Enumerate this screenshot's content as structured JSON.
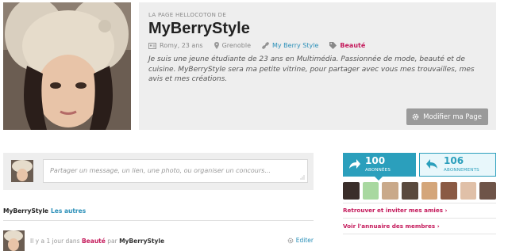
{
  "header": {
    "kicker": "LA PAGE HELLOCOTON DE",
    "title": "MyBerryStyle",
    "meta": {
      "owner": "Romy, 23 ans",
      "location": "Grenoble",
      "blog_link": "My Berry Style",
      "category": "Beauté"
    },
    "bio": "Je suis une jeune étudiante de 23 ans en Multimédia. Passionnée de mode, beauté et de cuisine. MyBerryStyle sera ma petite vitrine, pour partager avec vous mes trouvailles, mes avis et mes créations.",
    "edit_button": "Modifier ma Page"
  },
  "composer": {
    "placeholder": "Partager un message, un lien, une photo, ou organiser un concours..."
  },
  "tabs": {
    "active": "MyBerryStyle",
    "others": "Les autres"
  },
  "post": {
    "time": "Il y a 1 jour dans",
    "category": "Beauté",
    "by": "par",
    "author": "MyBerryStyle",
    "edit": "Editer"
  },
  "sidebar": {
    "followers": {
      "count": "100",
      "label": "ABONNÉES"
    },
    "subscriptions": {
      "count": "106",
      "label": "ABONNEMENTS"
    },
    "follower_colors": [
      "#3a2e2a",
      "#a8d8a0",
      "#c9a98a",
      "#5a4a3e",
      "#d4a67a",
      "#8a5a44",
      "#e0c0a8",
      "#6e5448"
    ],
    "invite_link": "Retrouver et inviter mes amies ›",
    "directory_link": "Voir l'annuaire des membres ›"
  },
  "colors": {
    "accent_blue": "#2b9fbc",
    "accent_pink": "#c4185a",
    "panel_gray": "#eeeeee"
  }
}
